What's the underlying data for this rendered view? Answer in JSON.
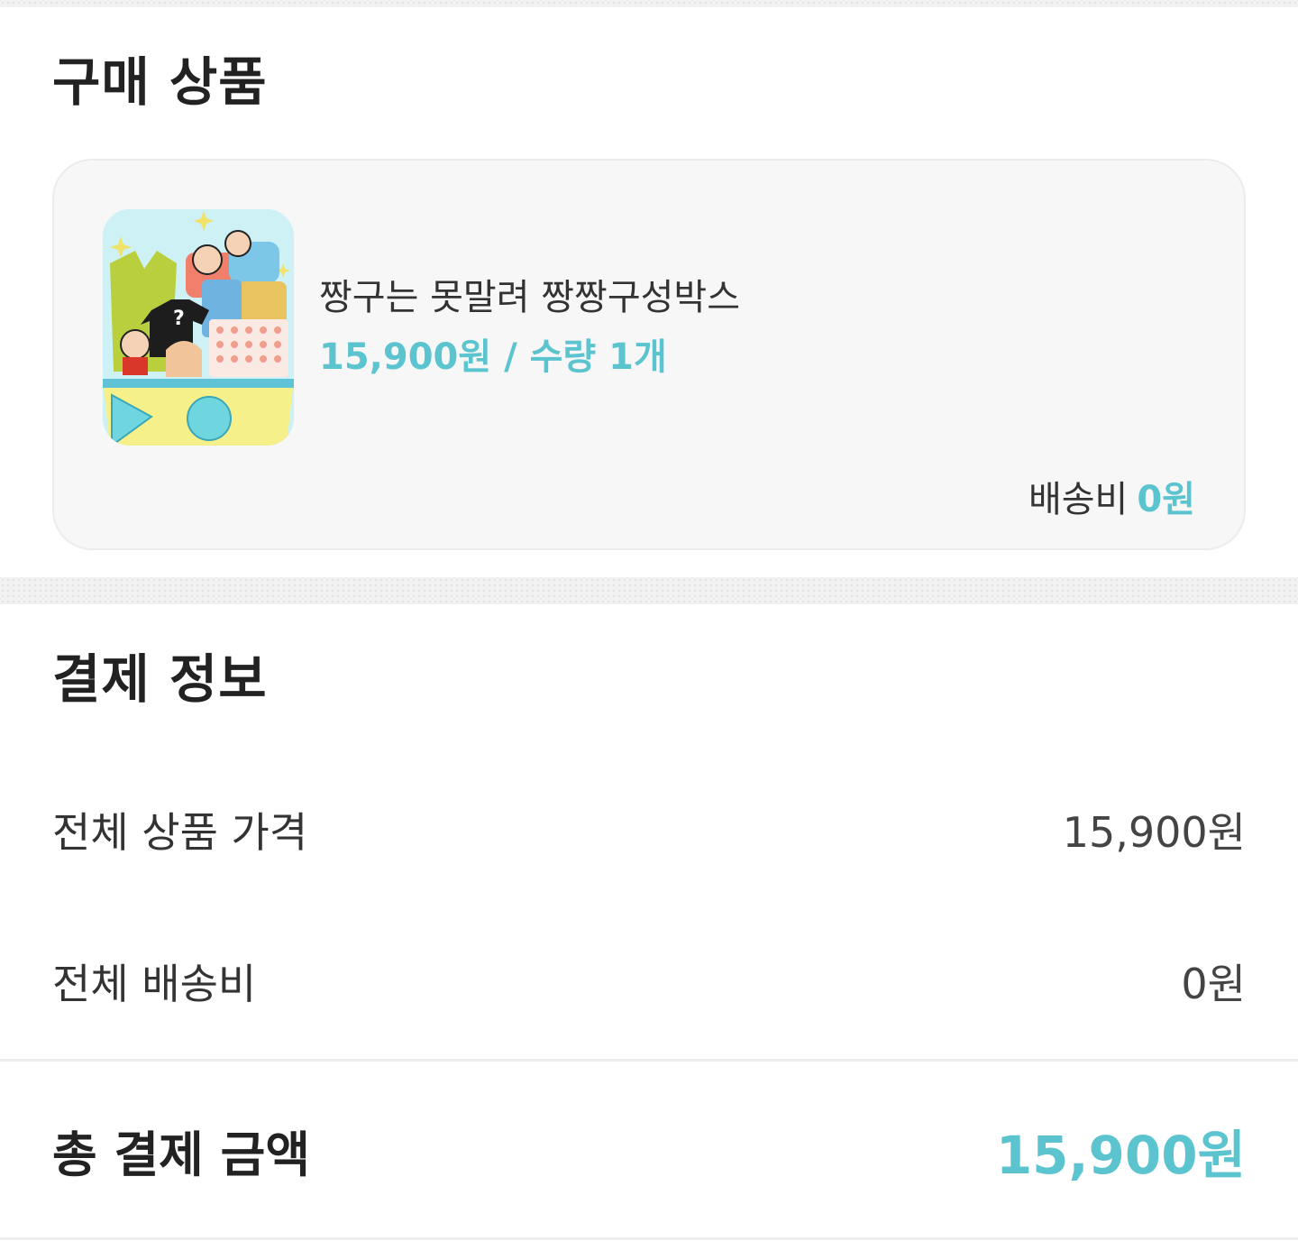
{
  "purchase_section": {
    "title": "구매 상품",
    "product": {
      "name": "짱구는 못말려 짱짱구성박스",
      "price_quantity": "15,900원 / 수량 1개",
      "image_icon": "product-box-illustration-icon"
    },
    "shipping": {
      "label": "배송비",
      "value": "0원"
    }
  },
  "payment_section": {
    "title": "결제 정보",
    "rows": [
      {
        "label": "전체 상품 가격",
        "value": "15,900원"
      },
      {
        "label": "전체 배송비",
        "value": "0원"
      }
    ],
    "total": {
      "label": "총 결제 금액",
      "value": "15,900원"
    }
  },
  "colors": {
    "accent": "#5bc4cf",
    "card_background": "#f7f7f7",
    "text": "#222222"
  }
}
